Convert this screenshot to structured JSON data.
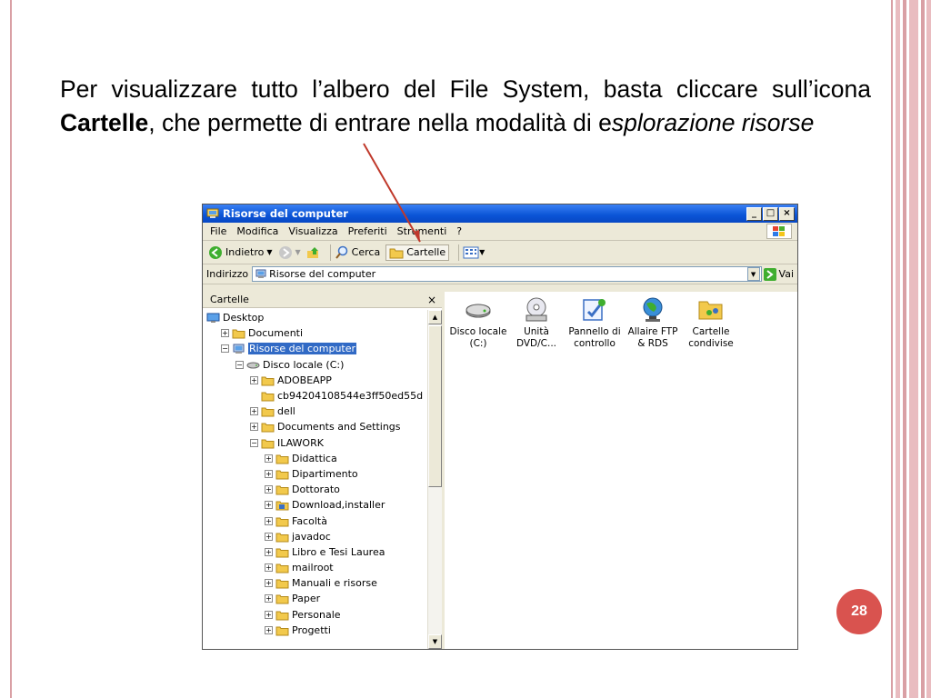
{
  "slide": {
    "text_part1": "Per visualizzare tutto l’albero del File System, basta cliccare sull’icona ",
    "text_bold": "Cartelle",
    "text_part2": ", che permette di entrare nella modalità di e",
    "text_italic": "splorazione risorse",
    "page_number": "28"
  },
  "window": {
    "title": "Risorse del computer",
    "controls": [
      "_",
      "□",
      "×"
    ],
    "menu": [
      "File",
      "Modifica",
      "Visualizza",
      "Preferiti",
      "Strumenti",
      "?"
    ],
    "toolbar": {
      "back": "Indietro",
      "search": "Cerca",
      "folders": "Cartelle"
    },
    "address": {
      "label": "Indirizzo",
      "value": "Risorse del computer",
      "go": "Vai"
    },
    "folders_pane": {
      "title": "Cartelle",
      "close": "×",
      "tree": [
        {
          "label": "Desktop",
          "level": 0,
          "expander": "",
          "icon": "desktop-icon"
        },
        {
          "label": "Documenti",
          "level": 1,
          "expander": "+",
          "icon": "folder-icon"
        },
        {
          "label": "Risorse del computer",
          "level": 1,
          "expander": "−",
          "icon": "computer-icon",
          "selected": true
        },
        {
          "label": "Disco locale (C:)",
          "level": 2,
          "expander": "−",
          "icon": "disk-icon"
        },
        {
          "label": "ADOBEAPP",
          "level": 3,
          "expander": "+",
          "icon": "folder-icon"
        },
        {
          "label": "cb94204108544e3ff50ed55d",
          "level": 3,
          "expander": "",
          "icon": "folder-icon"
        },
        {
          "label": "dell",
          "level": 3,
          "expander": "+",
          "icon": "folder-icon"
        },
        {
          "label": "Documents and Settings",
          "level": 3,
          "expander": "+",
          "icon": "folder-icon"
        },
        {
          "label": "ILAWORK",
          "level": 3,
          "expander": "−",
          "icon": "folder-icon"
        },
        {
          "label": "Didattica",
          "level": 4,
          "expander": "+",
          "icon": "folder-icon"
        },
        {
          "label": "Dipartimento",
          "level": 4,
          "expander": "+",
          "icon": "folder-icon"
        },
        {
          "label": "Dottorato",
          "level": 4,
          "expander": "+",
          "icon": "folder-icon"
        },
        {
          "label": "Download,installer",
          "level": 4,
          "expander": "+",
          "icon": "installer-folder-icon"
        },
        {
          "label": "Facoltà",
          "level": 4,
          "expander": "+",
          "icon": "folder-icon"
        },
        {
          "label": "javadoc",
          "level": 4,
          "expander": "+",
          "icon": "folder-icon"
        },
        {
          "label": "Libro e Tesi Laurea",
          "level": 4,
          "expander": "+",
          "icon": "folder-icon"
        },
        {
          "label": "mailroot",
          "level": 4,
          "expander": "+",
          "icon": "folder-icon"
        },
        {
          "label": "Manuali e risorse",
          "level": 4,
          "expander": "+",
          "icon": "folder-icon"
        },
        {
          "label": "Paper",
          "level": 4,
          "expander": "+",
          "icon": "folder-icon"
        },
        {
          "label": "Personale",
          "level": 4,
          "expander": "+",
          "icon": "folder-icon"
        },
        {
          "label": "Progetti",
          "level": 4,
          "expander": "+",
          "icon": "folder-icon"
        }
      ]
    },
    "content_items": [
      {
        "label_line1": "Disco locale",
        "label_line2": "(C:)",
        "icon": "hard-disk-icon"
      },
      {
        "label_line1": "Unità",
        "label_line2": "DVD/C...",
        "icon": "dvd-drive-icon"
      },
      {
        "label_line1": "Pannello di",
        "label_line2": "controllo",
        "icon": "control-panel-icon"
      },
      {
        "label_line1": "Allaire FTP",
        "label_line2": "& RDS",
        "icon": "ftp-globe-icon"
      },
      {
        "label_line1": "Cartelle",
        "label_line2": "condivise",
        "icon": "shared-folders-icon"
      }
    ]
  },
  "colors": {
    "accent": "#d9534f",
    "title_bar": "#0a54d6",
    "selection": "#316ac5",
    "arrow": "#c0392b"
  }
}
